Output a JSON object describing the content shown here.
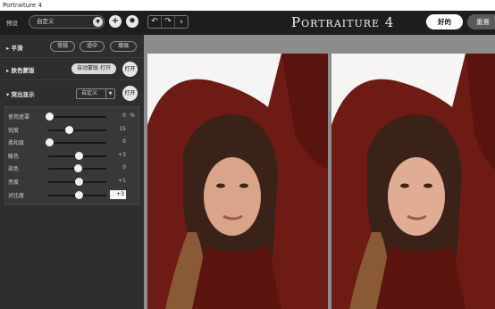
{
  "window": {
    "title": "Portraiture 4"
  },
  "toolbar": {
    "preset_label": "预设",
    "preset_value": "自定义",
    "add_label": "+",
    "undo_glyph": "↶",
    "redo_glyph": "↷",
    "history_glyph": "∨",
    "app_title": "Portraiture 4",
    "ok_label": "好的",
    "reset_label": "重置"
  },
  "sidebar": {
    "smooth": {
      "title": "平滑",
      "options": [
        "常规",
        "适中",
        "增强"
      ]
    },
    "skin_mask": {
      "title": "肤色蒙版",
      "auto_label": "自动蒙版 打开",
      "toggle_label": "打开"
    },
    "enhance": {
      "title": "突出显示",
      "mode_value": "自定义",
      "toggle_label": "打开"
    },
    "sliders": [
      {
        "label": "使用遮罩",
        "value": "0",
        "unit": "%",
        "level": 0.02
      },
      {
        "label": "锐度",
        "value": "15",
        "unit": "",
        "level": 0.35
      },
      {
        "label": "柔和度",
        "value": "0",
        "unit": "",
        "level": 0.02
      },
      {
        "label": "暖色",
        "value": "+3",
        "unit": "",
        "level": 0.53
      },
      {
        "label": "染色",
        "value": "0",
        "unit": "",
        "level": 0.5
      },
      {
        "label": "亮度",
        "value": "+1",
        "unit": "",
        "level": 0.52
      },
      {
        "label": "对比度",
        "value": "+3",
        "unit": "",
        "level": 0.53,
        "editing": true
      }
    ]
  },
  "colors": {
    "accent_white": "#ffffff",
    "panel": "#2e2e2e",
    "toolbar": "#1e1e1e",
    "preview_bg": "#8c8c8c"
  }
}
